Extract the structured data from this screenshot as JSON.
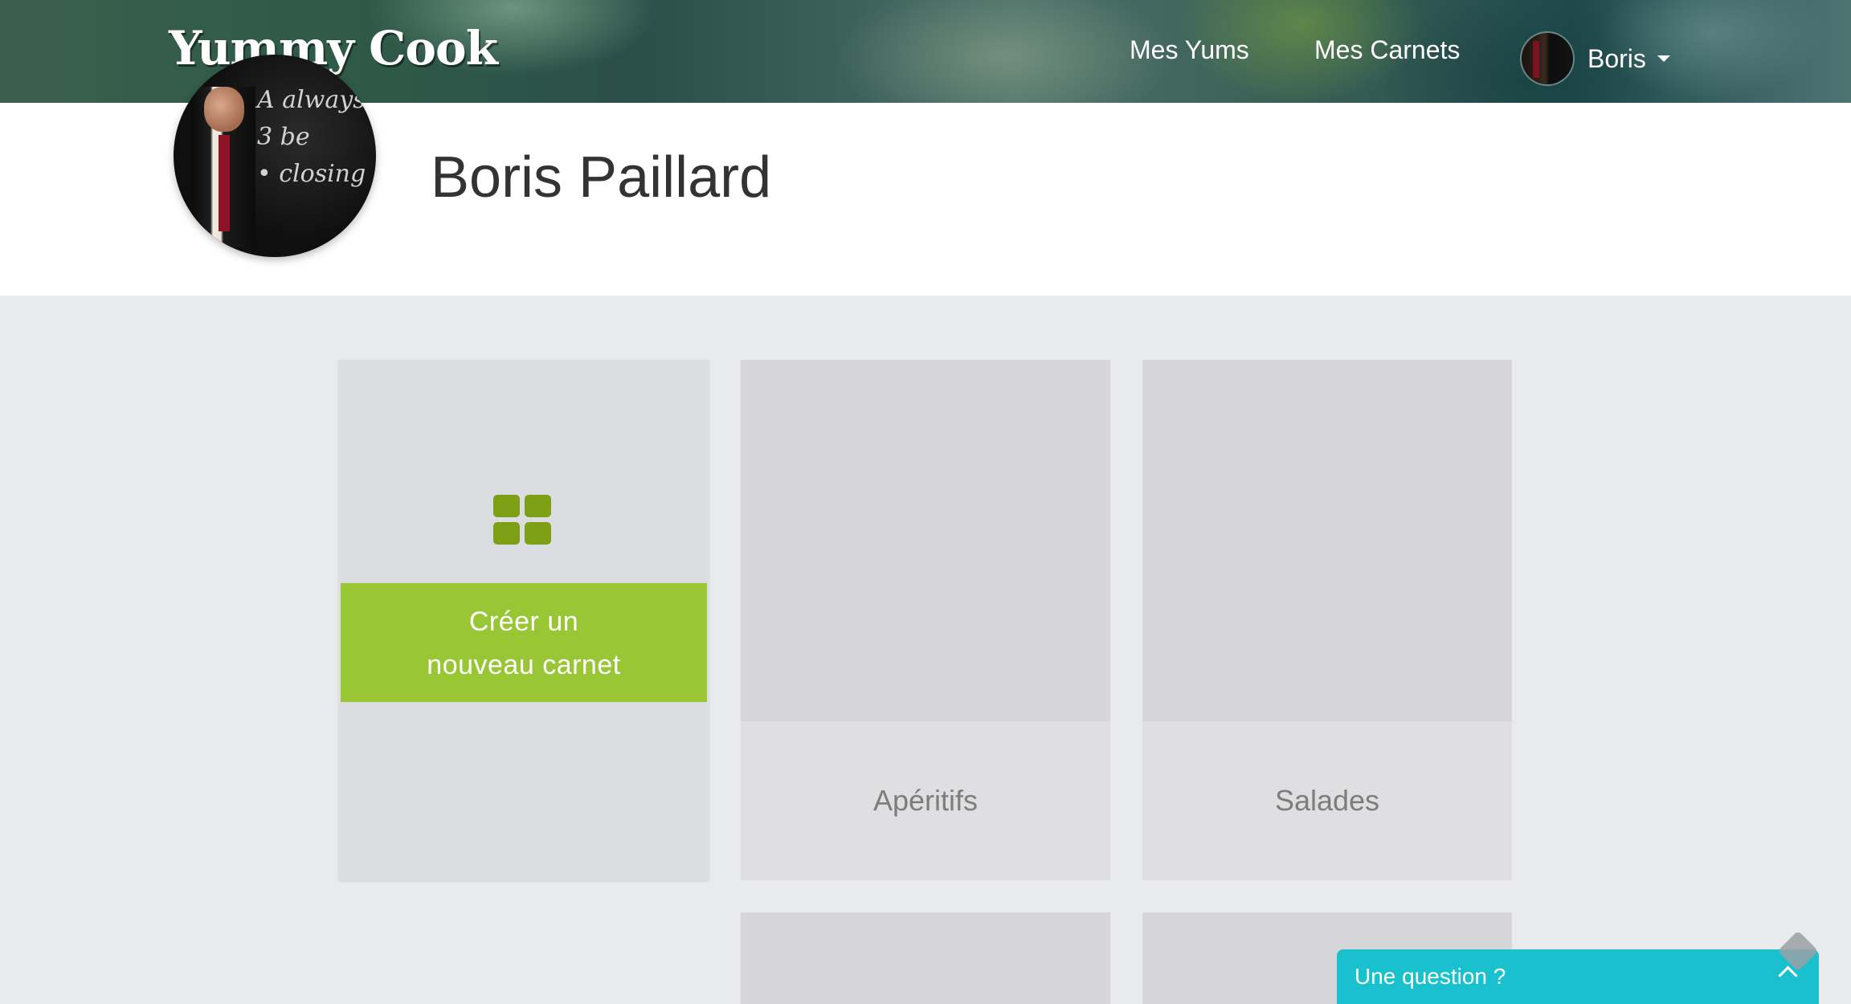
{
  "header": {
    "brand": "Yummy Cook",
    "nav": {
      "mes_yums": "Mes Yums",
      "mes_carnets": "Mes Carnets"
    },
    "user_menu": {
      "name": "Boris"
    }
  },
  "profile": {
    "name": "Boris Paillard",
    "avatar_chalk_text": "A always\n3 be\n• closing"
  },
  "create_card": {
    "label": "Créer un\nnouveau carnet"
  },
  "notebooks": [
    {
      "title": "Apéritifs"
    },
    {
      "title": "Salades"
    }
  ],
  "help_widget": {
    "label": "Une question ?"
  },
  "colors": {
    "accent_green": "#98c634",
    "icon_green": "#7ea016",
    "help_teal": "#19c1ce",
    "page_bg": "#e9eaec"
  }
}
